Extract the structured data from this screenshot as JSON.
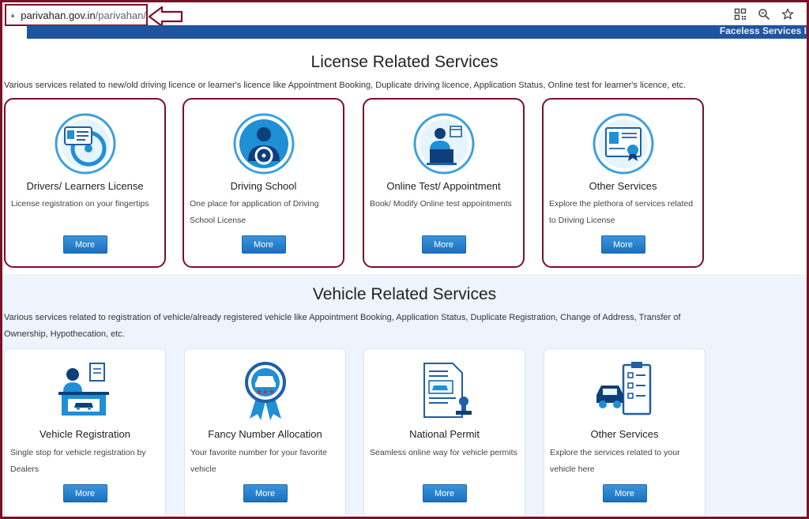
{
  "browser": {
    "url_host": "parivahan.gov.in",
    "url_path": "/parivahan/",
    "icons": [
      "lock-icon",
      "qr-code-icon",
      "zoom-icon",
      "star-icon"
    ]
  },
  "banner": {
    "text": "Faceless Services I"
  },
  "license_section": {
    "title": "License Related Services",
    "description": "Various services related to new/old driving licence or learner's licence like Appointment Booking, Duplicate driving licence, Application Status, Online test for learner's licence, etc.",
    "cards": [
      {
        "title": "Drivers/ Learners License",
        "desc": "License registration on your fingertips",
        "button": "More",
        "icon": "license-icon"
      },
      {
        "title": "Driving School",
        "desc": "One place for application of Driving School License",
        "button": "More",
        "icon": "driving-school-icon"
      },
      {
        "title": "Online Test/ Appointment",
        "desc": "Book/ Modify Online test appointments",
        "button": "More",
        "icon": "online-test-icon"
      },
      {
        "title": "Other Services",
        "desc": "Explore the plethora of services related to Driving License",
        "button": "More",
        "icon": "certificate-icon"
      }
    ]
  },
  "vehicle_section": {
    "title": "Vehicle Related Services",
    "description": "Various services related to registration of vehicle/already registered vehicle like Appointment Booking, Application Status, Duplicate Registration, Change of Address, Transfer of Ownership, Hypothecation, etc.",
    "cards": [
      {
        "title": "Vehicle Registration",
        "desc": "Single stop for vehicle registration by Dealers",
        "button": "More",
        "icon": "vehicle-registration-icon"
      },
      {
        "title": "Fancy Number Allocation",
        "desc": "Your favorite number for your favorite vehicle",
        "button": "More",
        "icon": "fancy-number-badge-icon"
      },
      {
        "title": "National Permit",
        "desc": "Seamless online way for vehicle permits",
        "button": "More",
        "icon": "permit-document-icon"
      },
      {
        "title": "Other Services",
        "desc": "Explore the services related to your vehicle here",
        "button": "More",
        "icon": "vehicle-checklist-icon"
      }
    ]
  },
  "colors": {
    "accent": "#1f55a0",
    "highlight_border": "#7b1026",
    "button": "#1c70bf",
    "vehicle_bg": "#eef4fc"
  }
}
